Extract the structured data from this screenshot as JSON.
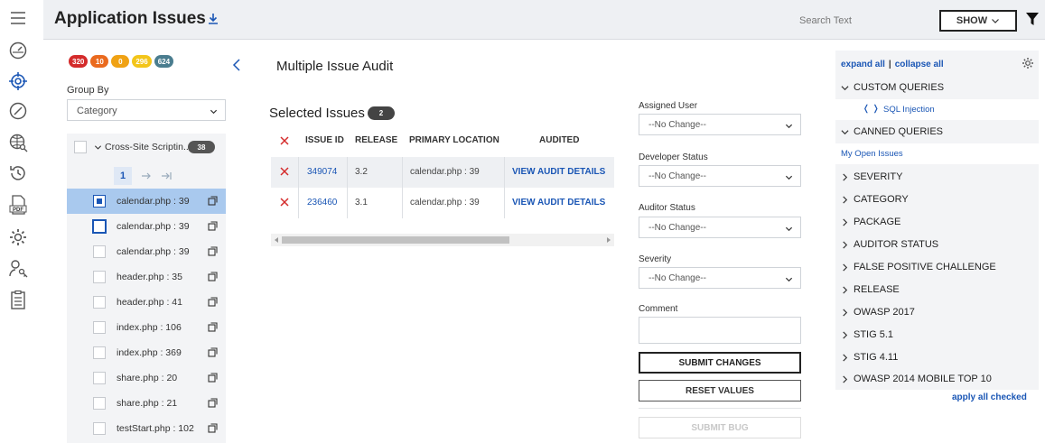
{
  "header": {
    "title": "Application Issues",
    "search_placeholder": "Search Text",
    "show_label": "SHOW"
  },
  "rail": {
    "icons": [
      "menu-icon",
      "dashboard-icon",
      "issues-target-icon",
      "speedometer-icon",
      "web-search-icon",
      "history-icon",
      "pdf-icon",
      "settings-gear-icon",
      "user-key-icon",
      "clipboard-icon"
    ],
    "active_color": "#1a56b5"
  },
  "badges": [
    {
      "value": "320",
      "color": "#d42b2b"
    },
    {
      "value": "10",
      "color": "#ea6a1e"
    },
    {
      "value": "0",
      "color": "#f0a214"
    },
    {
      "value": "296",
      "color": "#f3c51a"
    },
    {
      "value": "624",
      "color": "#4a7d8f"
    }
  ],
  "group_by": {
    "label": "Group By",
    "value": "Category"
  },
  "group": {
    "label": "Cross-Site Scriptin...",
    "count": "38",
    "page": "1"
  },
  "files": [
    {
      "label": "calendar.php : 39"
    },
    {
      "label": "calendar.php : 39"
    },
    {
      "label": "calendar.php : 39"
    },
    {
      "label": "header.php : 35"
    },
    {
      "label": "header.php : 41"
    },
    {
      "label": "index.php : 106"
    },
    {
      "label": "index.php : 369"
    },
    {
      "label": "share.php : 20"
    },
    {
      "label": "share.php : 21"
    },
    {
      "label": "testStart.php : 102"
    }
  ],
  "audit": {
    "title": "Multiple Issue Audit",
    "selected_label": "Selected Issues",
    "selected_count": "2",
    "columns": [
      "ISSUE ID",
      "RELEASE",
      "PRIMARY LOCATION",
      "AUDITED"
    ],
    "rows": [
      {
        "issue_id": "349074",
        "release": "3.2",
        "location": "calendar.php : 39",
        "audited": "VIEW AUDIT DETAILS"
      },
      {
        "issue_id": "236460",
        "release": "3.1",
        "location": "calendar.php : 39",
        "audited": "VIEW AUDIT DETAILS"
      }
    ]
  },
  "form": {
    "assigned_user_label": "Assigned User",
    "assigned_user_value": "--No Change--",
    "developer_status_label": "Developer Status",
    "developer_status_value": "--No Change--",
    "auditor_status_label": "Auditor Status",
    "auditor_status_value": "--No Change--",
    "severity_label": "Severity",
    "severity_value": "--No Change--",
    "comment_label": "Comment",
    "submit_label": "SUBMIT CHANGES",
    "reset_label": "RESET VALUES",
    "bug_label": "SUBMIT BUG"
  },
  "queries": {
    "expand_all": "expand all",
    "divider": "|",
    "collapse_all": "collapse all",
    "custom_label": "CUSTOM QUERIES",
    "custom_item": "SQL Injection",
    "canned_label": "CANNED QUERIES",
    "canned_item": "My Open Issues",
    "filters": [
      "SEVERITY",
      "CATEGORY",
      "PACKAGE",
      "AUDITOR STATUS",
      "FALSE POSITIVE CHALLENGE",
      "RELEASE",
      "OWASP 2017",
      "STIG 5.1",
      "STIG 4.11",
      "OWASP 2014 MOBILE TOP 10"
    ],
    "apply_label": "apply all checked"
  }
}
